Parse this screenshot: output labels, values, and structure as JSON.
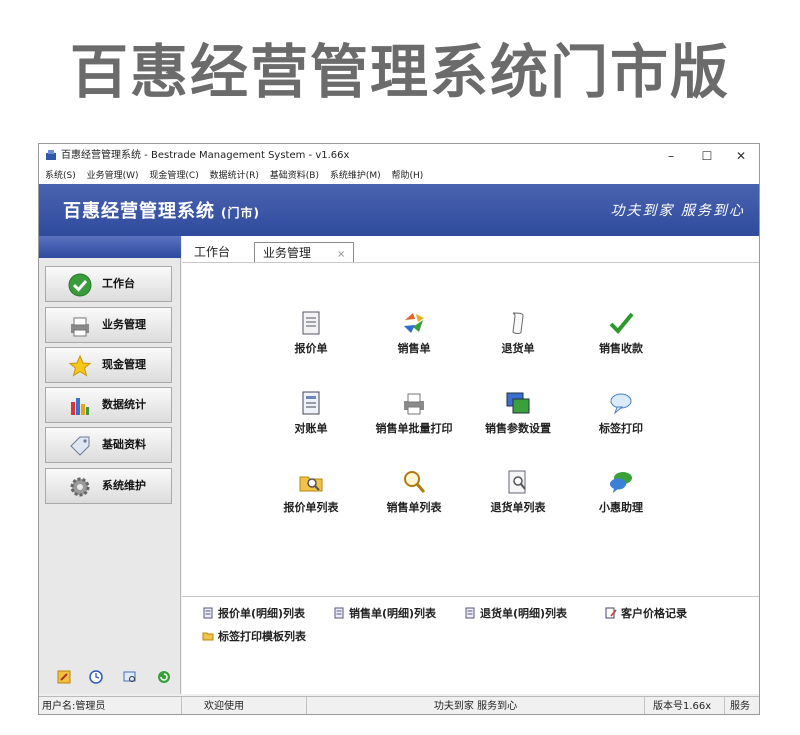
{
  "banner_title": "百惠经营管理系统门市版",
  "window": {
    "title": "百惠经营管理系统 - Bestrade Management System - v1.66x",
    "minimize": "–",
    "maximize": "☐",
    "close": "✕"
  },
  "menu": [
    "系统(S)",
    "业务管理(W)",
    "现金管理(C)",
    "数据统计(R)",
    "基础资料(B)",
    "系统维护(M)",
    "帮助(H)"
  ],
  "header": {
    "system_name": "百惠经营管理系统",
    "edition": "(门市)",
    "slogan": "功夫到家 服务到心"
  },
  "sidebar": {
    "items": [
      {
        "label": "工作台",
        "icon": "check-icon"
      },
      {
        "label": "业务管理",
        "icon": "printer-icon"
      },
      {
        "label": "现金管理",
        "icon": "star-icon"
      },
      {
        "label": "数据统计",
        "icon": "bar-chart-icon"
      },
      {
        "label": "基础资料",
        "icon": "tag-icon"
      },
      {
        "label": "系统维护",
        "icon": "gear-icon"
      }
    ]
  },
  "tabs": [
    {
      "label": "工作台",
      "active": false
    },
    {
      "label": "业务管理",
      "active": true,
      "close": "×"
    }
  ],
  "functions": [
    {
      "label": "报价单",
      "icon": "document-icon"
    },
    {
      "label": "销售单",
      "icon": "recycle-icon"
    },
    {
      "label": "退货单",
      "icon": "scroll-icon"
    },
    {
      "label": "销售收款",
      "icon": "checkmark-icon"
    },
    {
      "label": "对账单",
      "icon": "ledger-icon"
    },
    {
      "label": "销售单批量打印",
      "icon": "printer-icon"
    },
    {
      "label": "销售参数设置",
      "icon": "settings-window-icon"
    },
    {
      "label": "标签打印",
      "icon": "speech-bubble-icon"
    },
    {
      "label": "报价单列表",
      "icon": "search-folder-icon"
    },
    {
      "label": "销售单列表",
      "icon": "magnifier-icon"
    },
    {
      "label": "退货单列表",
      "icon": "search-document-icon"
    },
    {
      "label": "小惠助理",
      "icon": "chat-icon"
    }
  ],
  "quick_links": [
    {
      "label": "报价单(明细)列表",
      "icon": "list-doc-icon"
    },
    {
      "label": "销售单(明细)列表",
      "icon": "list-doc-icon"
    },
    {
      "label": "退货单(明细)列表",
      "icon": "list-doc-icon"
    },
    {
      "label": "客户价格记录",
      "icon": "edit-doc-icon"
    },
    {
      "label": "标签打印模板列表",
      "icon": "folder-icon"
    }
  ],
  "status": {
    "user": "用户名:管理员",
    "welcome": "欢迎使用",
    "slogan": "功夫到家 服务到心",
    "version": "版本号1.66x",
    "service": "服务"
  },
  "colors": {
    "header_blue": "#3a55a8",
    "banner_gray": "#6b6b6b"
  }
}
